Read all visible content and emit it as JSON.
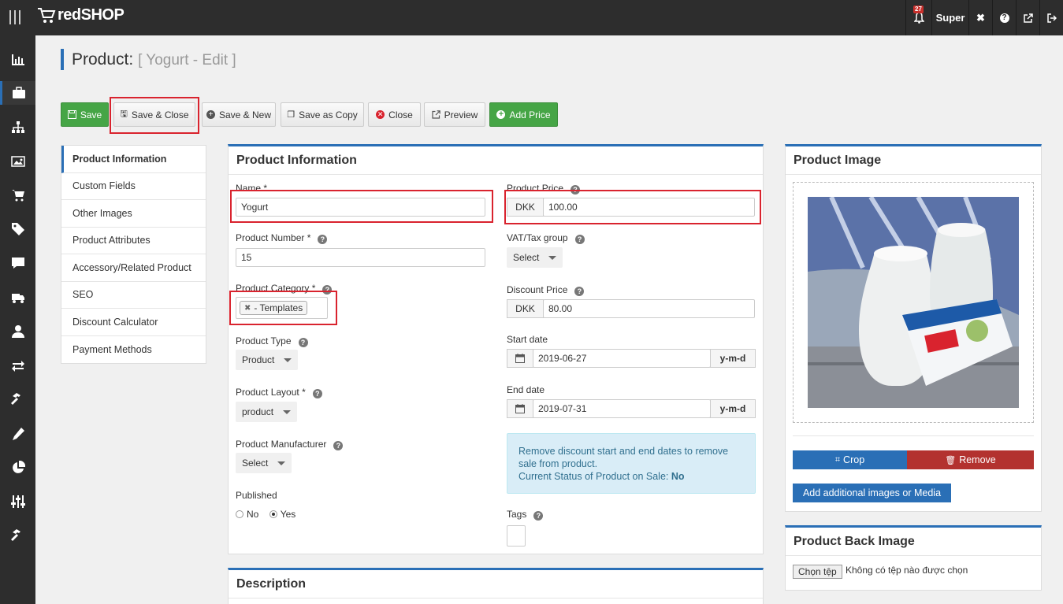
{
  "topbar": {
    "brand": "redSHOP",
    "notifications": "27",
    "user": "Super"
  },
  "header": {
    "title": "Product:",
    "subtitle": "[ Yogurt - Edit ]"
  },
  "toolbar": {
    "save": "Save",
    "save_close": "Save & Close",
    "save_new": "Save & New",
    "save_copy": "Save as Copy",
    "close": "Close",
    "preview": "Preview",
    "add_price": "Add Price"
  },
  "tabs": [
    "Product Information",
    "Custom Fields",
    "Other Images",
    "Product Attributes",
    "Accessory/Related Product",
    "SEO",
    "Discount Calculator",
    "Payment Methods"
  ],
  "info": {
    "title": "Product Information",
    "name_label": "Name",
    "name_value": "Yogurt",
    "number_label": "Product Number",
    "number_value": "15",
    "category_label": "Product Category",
    "category_value": "- Templates",
    "type_label": "Product Type",
    "type_value": "Product",
    "layout_label": "Product Layout",
    "layout_value": "product",
    "manufacturer_label": "Product Manufacturer",
    "manufacturer_value": "Select",
    "published_label": "Published",
    "published_no": "No",
    "published_yes": "Yes",
    "price_label": "Product Price",
    "currency": "DKK",
    "price_value": "100.00",
    "vat_label": "VAT/Tax group",
    "vat_value": "Select",
    "discount_label": "Discount Price",
    "discount_value": "80.00",
    "start_label": "Start date",
    "start_value": "2019-06-27",
    "end_label": "End date",
    "end_value": "2019-07-31",
    "date_format": "y-m-d",
    "info_text": "Remove discount start and end dates to remove sale from product.",
    "status_label": "Current Status of Product on Sale:",
    "status_value": "No",
    "tags_label": "Tags"
  },
  "description": {
    "title": "Description"
  },
  "image_panel": {
    "title": "Product Image",
    "crop": "Crop",
    "remove": "Remove",
    "add_media": "Add additional images or Media"
  },
  "back_image": {
    "title": "Product Back Image",
    "choose": "Chọn tệp",
    "no_file": "Không có tệp nào được chọn"
  }
}
